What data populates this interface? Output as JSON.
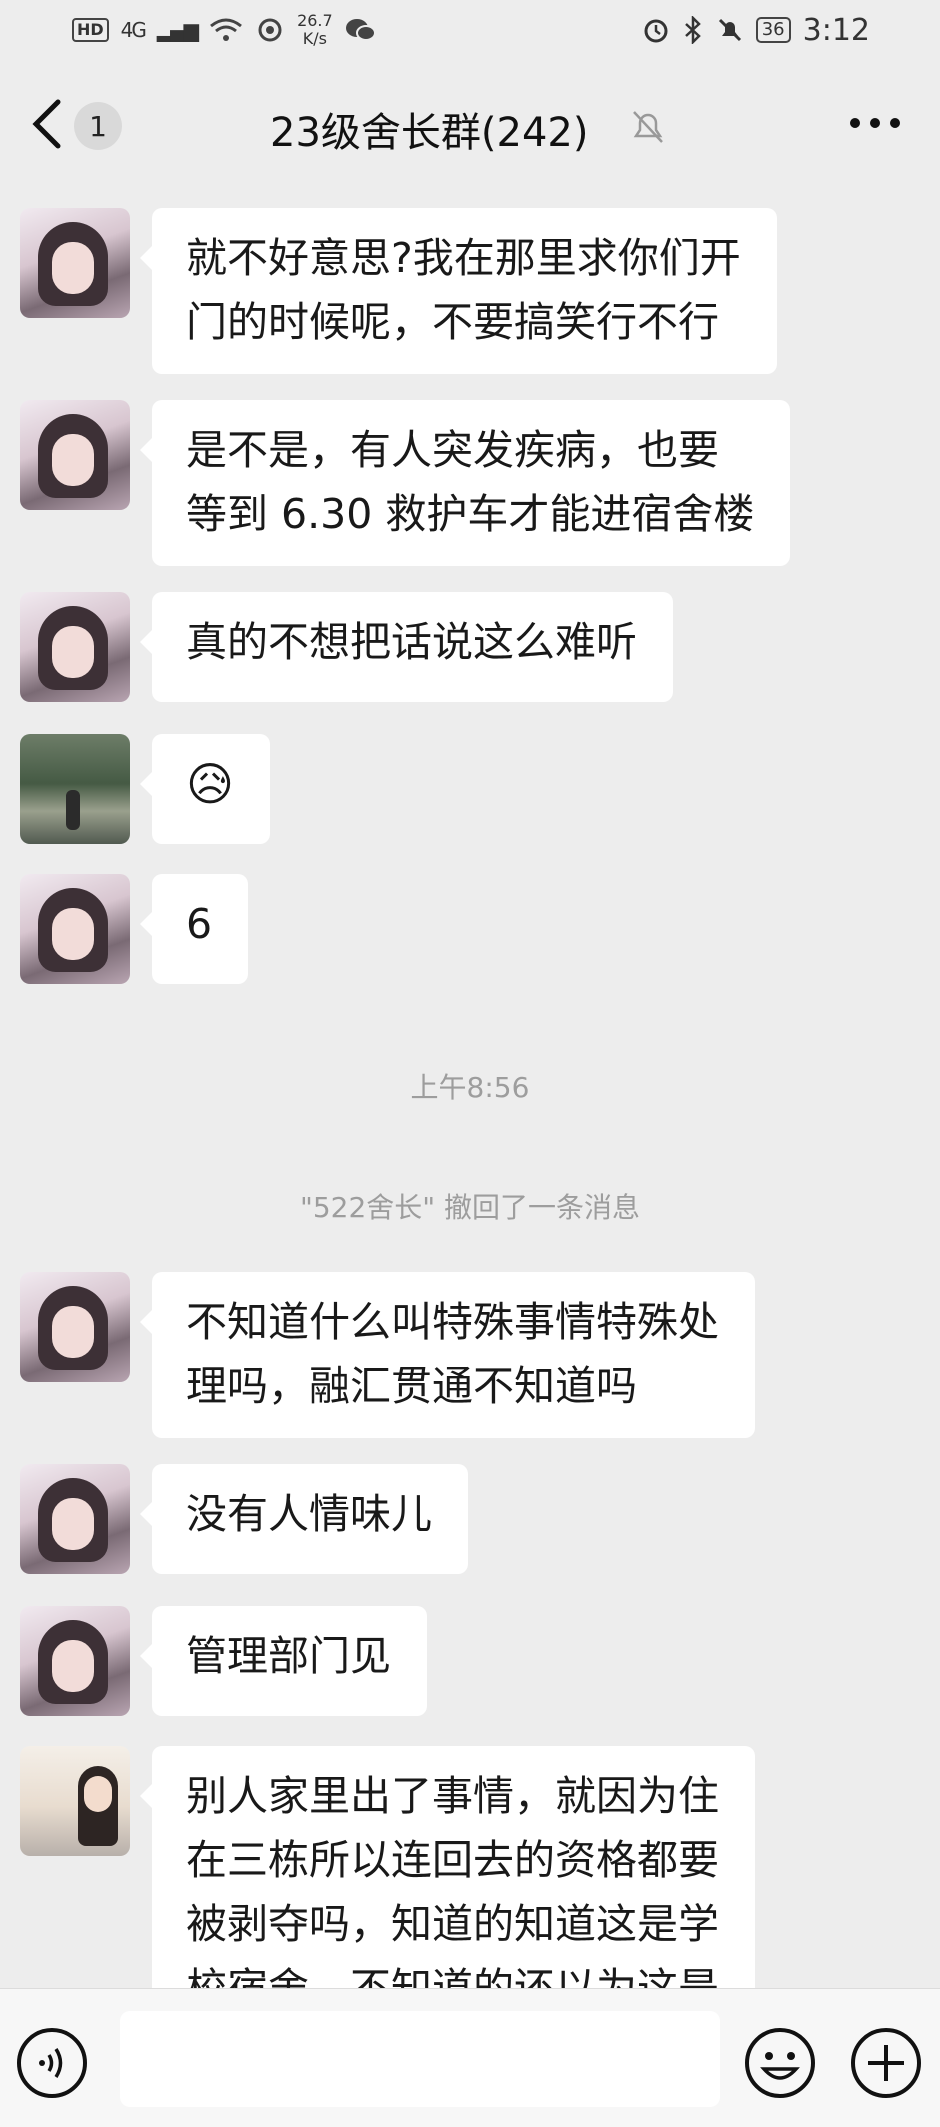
{
  "status_bar": {
    "hd": "HD",
    "network": "4G",
    "signal": "▂▄▆",
    "speed_value": "26.7",
    "speed_unit": "K/s",
    "battery": "36",
    "time": "3:12"
  },
  "header": {
    "unread_count": "1",
    "title": "23级舍长群(242)"
  },
  "messages": [
    {
      "lines": [
        "就不好意思?我在那里求你们开",
        "门的时候呢，不要搞笑行不行"
      ]
    },
    {
      "lines": [
        "是不是，有人突发疾病，也要",
        "等到 6.30 救护车才能进宿舍楼"
      ]
    },
    {
      "lines": [
        "真的不想把话说这么难听"
      ]
    },
    {
      "emoji": "😥"
    },
    {
      "lines": [
        "6"
      ]
    },
    {
      "lines": [
        "不知道什么叫特殊事情特殊处",
        "理吗，融汇贯通不知道吗"
      ]
    },
    {
      "lines": [
        "没有人情味儿"
      ]
    },
    {
      "lines": [
        "管理部门见"
      ]
    },
    {
      "lines": [
        "别人家里出了事情，就因为住",
        "在三栋所以连回去的资格都要",
        "被剥夺吗，知道的知道这是学",
        "校宿舍，不知道的还以为这是"
      ]
    }
  ],
  "timestamp": "上午8:56",
  "recall_notice": "\"522舍长\" 撤回了一条消息",
  "input": {
    "placeholder": ""
  },
  "colors": {
    "background": "#ededed",
    "bubble": "#ffffff",
    "system_text": "#9d9d9d"
  }
}
